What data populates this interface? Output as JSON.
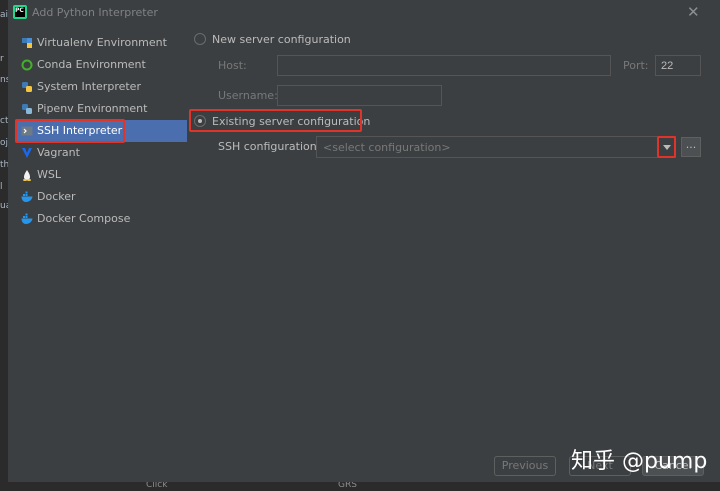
{
  "ide": {
    "left_fragments": [
      "ai",
      "r",
      "ns",
      "ct",
      "oj",
      "th",
      "l",
      "ua"
    ],
    "bottom_fragments": [
      "Click",
      "GRS"
    ]
  },
  "dialog": {
    "title": "Add Python Interpreter",
    "close_icon": "close-icon"
  },
  "sidebar": {
    "items": [
      {
        "label": "Virtualenv Environment",
        "icon": "virtualenv-icon",
        "selected": false
      },
      {
        "label": "Conda Environment",
        "icon": "conda-icon",
        "selected": false
      },
      {
        "label": "System Interpreter",
        "icon": "python-icon",
        "selected": false
      },
      {
        "label": "Pipenv Environment",
        "icon": "pipenv-icon",
        "selected": false
      },
      {
        "label": "SSH Interpreter",
        "icon": "ssh-icon",
        "selected": true
      },
      {
        "label": "Vagrant",
        "icon": "vagrant-icon",
        "selected": false
      },
      {
        "label": "WSL",
        "icon": "wsl-icon",
        "selected": false
      },
      {
        "label": "Docker",
        "icon": "docker-icon",
        "selected": false
      },
      {
        "label": "Docker Compose",
        "icon": "docker-compose-icon",
        "selected": false
      }
    ]
  },
  "form": {
    "new_server_label": "New server configuration",
    "host_label": "Host:",
    "host_value": "",
    "port_label": "Port:",
    "port_value": "22",
    "username_label": "Username:",
    "username_value": "",
    "existing_label": "Existing server configuration",
    "ssh_config_label": "SSH configuration:",
    "ssh_config_placeholder": "<select configuration>",
    "browse_label": "..."
  },
  "buttons": {
    "previous": "Previous",
    "next": "Next",
    "cancel": "Cancel"
  },
  "watermark": "知乎 @pump",
  "colors": {
    "background": "#3c3f41",
    "selection": "#4b6eaf",
    "highlight": "#e0332a"
  }
}
